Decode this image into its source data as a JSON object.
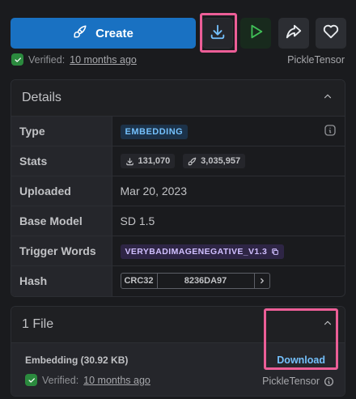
{
  "actions": {
    "create_label": "Create"
  },
  "verified": {
    "label": "Verified:",
    "time": "10 months ago",
    "author": "PickleTensor"
  },
  "details": {
    "title": "Details",
    "rows": {
      "type_label": "Type",
      "type_value": "EMBEDDING",
      "stats_label": "Stats",
      "downloads": "131,070",
      "generations": "3,035,957",
      "uploaded_label": "Uploaded",
      "uploaded_value": "Mar 20, 2023",
      "base_label": "Base Model",
      "base_value": "SD 1.5",
      "trigger_label": "Trigger Words",
      "trigger_value": "VERYBADIMAGENEGATIVE_V1.3",
      "hash_label": "Hash",
      "hash_type": "CRC32",
      "hash_value": "8236DA97"
    }
  },
  "files": {
    "title": "1 File",
    "file_name": "Embedding (30.92 KB)",
    "download_label": "Download",
    "verified_label": "Verified:",
    "verified_time": "10 months ago",
    "author": "PickleTensor"
  },
  "colors": {
    "primary": "#1971c2",
    "success": "#2b8a3e",
    "highlight": "#ec5e97",
    "link": "#74c0fc"
  }
}
